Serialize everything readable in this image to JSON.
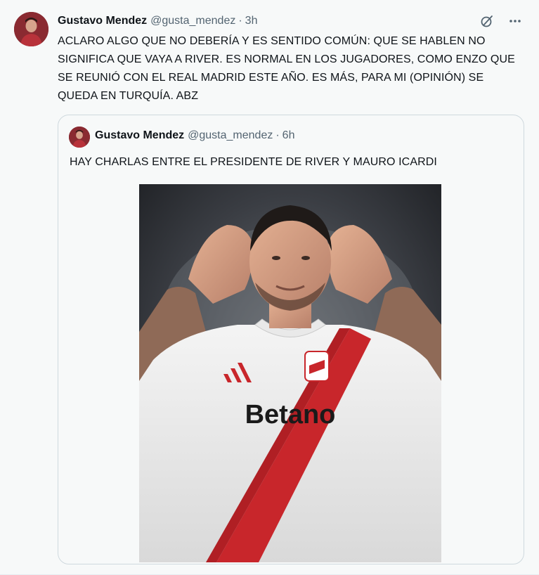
{
  "tweet": {
    "author_name": "Gustavo Mendez",
    "author_handle": "@gusta_mendez",
    "separator": "·",
    "time": "3h",
    "text": "ACLARO ALGO QUE NO DEBERÍA Y ES SENTIDO COMÚN: QUE SE HABLEN NO SIGNIFICA QUE VAYA A RIVER. ES NORMAL EN LOS JUGADORES, COMO ENZO QUE SE REUNIÓ CON EL REAL MADRID ESTE AÑO. ES MÁS, PARA MI (OPINIÓN) SE QUEDA EN TURQUÍA. ABZ",
    "icons": {
      "grok": "grok-icon",
      "more": "more-options-icon"
    }
  },
  "quoted_tweet": {
    "author_name": "Gustavo Mendez",
    "author_handle": "@gusta_mendez",
    "separator": "·",
    "time": "6h",
    "text": "HAY CHARLAS ENTRE EL PRESIDENTE DE RIVER Y MAURO ICARDI",
    "image": {
      "jersey_sponsor": "Betano",
      "description_icon": "player-photo"
    }
  },
  "colors": {
    "background": "#f7f9f9",
    "text": "#0f1419",
    "secondary_text": "#536471",
    "border": "#cfd9de",
    "river_red": "#c8262b"
  }
}
